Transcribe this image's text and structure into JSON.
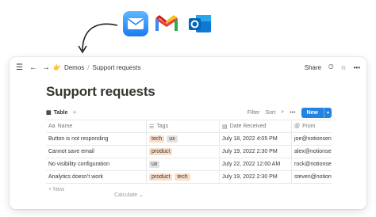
{
  "breadcrumb": {
    "emoji": "👉",
    "items": [
      "Demos",
      "Support requests"
    ]
  },
  "topbar": {
    "share_label": "Share"
  },
  "page": {
    "title": "Support requests"
  },
  "view": {
    "tab_label": "Table",
    "filter_label": "Filter",
    "sort_label": "Sort",
    "new_label": "New"
  },
  "table": {
    "columns": [
      "Name",
      "Tags",
      "Date Received",
      "From"
    ],
    "rows": [
      {
        "name": "Button is not responding",
        "tags": [
          "tech",
          "ux"
        ],
        "date": "July 18, 2022 4:05 PM",
        "from": "joe@notionsender.com"
      },
      {
        "name": "Cannot save email",
        "tags": [
          "product"
        ],
        "date": "July 19, 2022 2:30 PM",
        "from": "alex@notionsender.com"
      },
      {
        "name": "No visibility configuration",
        "tags": [
          "ux"
        ],
        "date": "July 22, 2022 12:00 AM",
        "from": "rock@notionsender.com"
      },
      {
        "name": "Analytics doesn't work",
        "tags": [
          "product",
          "tech"
        ],
        "date": "July 19, 2022 2:30 PM",
        "from": "steven@notionsender.com"
      }
    ],
    "new_row_label": "New",
    "calculate_label": "Calculate"
  },
  "icons": [
    "mail-app-icon",
    "gmail-icon",
    "outlook-icon"
  ],
  "colors": {
    "accent": "#2383e2",
    "tag_orange": "#fadec9",
    "tag_gray": "#e3e2e0"
  }
}
